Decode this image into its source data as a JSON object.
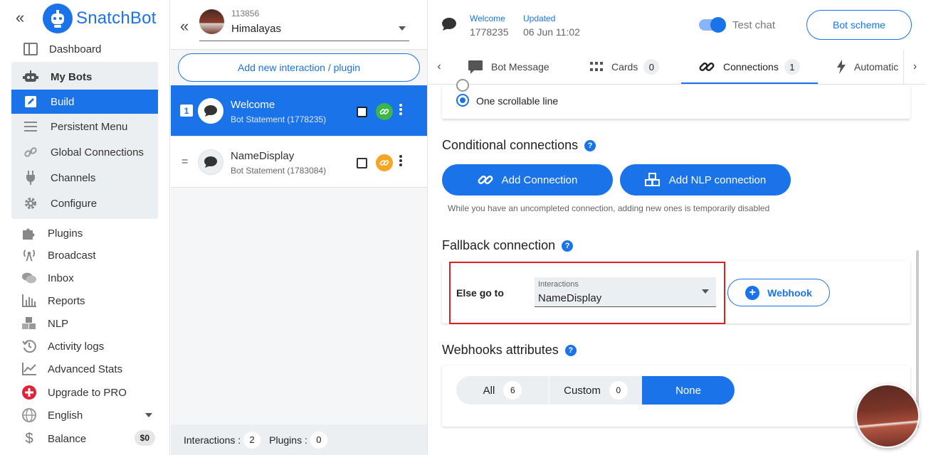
{
  "nav": {
    "brand": "SnatchBot",
    "items": [
      {
        "label": "Dashboard",
        "icon": "dashboard-icon"
      },
      {
        "label": "My Bots",
        "icon": "robot-icon"
      },
      {
        "label": "Build",
        "icon": "edit-icon"
      },
      {
        "label": "Persistent Menu",
        "icon": "menu-icon"
      },
      {
        "label": "Global Connections",
        "icon": "link-icon"
      },
      {
        "label": "Channels",
        "icon": "plug-icon"
      },
      {
        "label": "Configure",
        "icon": "gear-icon"
      },
      {
        "label": "Plugins",
        "icon": "puzzle-icon"
      },
      {
        "label": "Broadcast",
        "icon": "broadcast-icon"
      },
      {
        "label": "Inbox",
        "icon": "chat-icon"
      },
      {
        "label": "Reports",
        "icon": "bar-chart-icon"
      },
      {
        "label": "NLP",
        "icon": "cubes-icon"
      },
      {
        "label": "Activity logs",
        "icon": "history-icon"
      },
      {
        "label": "Advanced Stats",
        "icon": "line-chart-icon"
      },
      {
        "label": "Upgrade to PRO",
        "icon": "plus-badge-icon"
      },
      {
        "label": "English",
        "icon": "globe-icon"
      },
      {
        "label": "Balance",
        "icon": "dollar-icon"
      }
    ],
    "balance_value": "$0"
  },
  "bot": {
    "id": "113856",
    "name": "Himalayas"
  },
  "interactions": {
    "add_label": "Add new interaction / plugin",
    "rows": [
      {
        "index": "1",
        "name": "Welcome",
        "sub": "Bot Statement (1778235)"
      },
      {
        "index": "=",
        "name": "NameDisplay",
        "sub": "Bot Statement (1783084)"
      }
    ],
    "footer": {
      "interactions_label": "Interactions :",
      "interactions_count": "2",
      "plugins_label": "Plugins :",
      "plugins_count": "0"
    }
  },
  "header": {
    "welcome_label": "Welcome",
    "welcome_value": "1778235",
    "updated_label": "Updated",
    "updated_value": "06 Jun 11:02",
    "test_chat_label": "Test chat",
    "test_chat_on": true,
    "bot_scheme_label": "Bot scheme"
  },
  "tabs": [
    {
      "label": "Bot Message",
      "count": ""
    },
    {
      "label": "Cards",
      "count": "0"
    },
    {
      "label": "Connections",
      "count": "1"
    },
    {
      "label": "Automatic",
      "count": ""
    }
  ],
  "connections": {
    "radio_label": "One scrollable line",
    "conditional_title": "Conditional connections",
    "add_connection_label": "Add Connection",
    "add_nlp_label": "Add NLP connection",
    "hint": "While you have an uncompleted connection, adding new ones is temporarily disabled",
    "fallback_title": "Fallback connection",
    "else_label": "Else go to",
    "select_label": "Interactions",
    "select_value": "NameDisplay",
    "webhook_label": "Webhook",
    "webhooks_title": "Webhooks attributes",
    "seg_all": "All",
    "seg_all_count": "6",
    "seg_custom": "Custom",
    "seg_custom_count": "0",
    "seg_none": "None"
  },
  "colors": {
    "accent": "#1a73e8",
    "link_green": "#3cb54a",
    "link_orange": "#f5a623",
    "highlight_red": "#e02020"
  }
}
